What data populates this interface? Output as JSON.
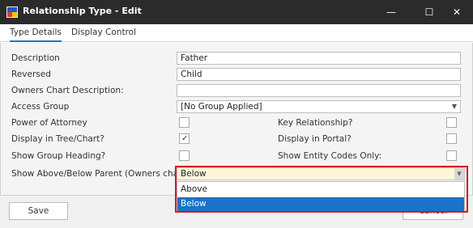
{
  "window": {
    "title": "Relationship Type - Edit",
    "minimize_glyph": "—",
    "maximize_glyph": "☐",
    "close_glyph": "✕"
  },
  "tabs": [
    {
      "label": "Type Details",
      "active": true
    },
    {
      "label": "Display Control",
      "active": false
    }
  ],
  "form": {
    "description": {
      "label": "Description",
      "value": "Father"
    },
    "reversed": {
      "label": "Reversed",
      "value": "Child"
    },
    "owners_chart_description": {
      "label": "Owners Chart Description:",
      "value": ""
    },
    "access_group": {
      "label": "Access Group",
      "value": "[No Group Applied]",
      "arrow": "▼"
    },
    "power_of_attorney": {
      "label": "Power of Attorney",
      "checked": false
    },
    "key_relationship": {
      "label": "Key Relationship?",
      "checked": false
    },
    "display_in_tree": {
      "label": "Display in Tree/Chart?",
      "checked": true,
      "mark": "✓"
    },
    "display_in_portal": {
      "label": "Display in Portal?",
      "checked": false
    },
    "show_group_heading": {
      "label": "Show Group Heading?",
      "checked": false
    },
    "show_entity_codes": {
      "label": "Show Entity Codes Only:",
      "checked": false
    },
    "show_above_below": {
      "label": "Show Above/Below Parent (Owners chart):",
      "value": "Below",
      "arrow": "▼",
      "options": [
        "Above",
        "Below"
      ],
      "highlighted_option": "Below"
    }
  },
  "footer": {
    "save_label": "Save",
    "cancel_label": "Cancel"
  },
  "colors": {
    "titlebar": "#2b2b2b",
    "selection": "#1a73c8",
    "highlight_border": "#d11a2a",
    "dropdown_field": "#fdf6d8"
  },
  "icons": [
    "app-icon",
    "minimize-icon",
    "maximize-icon",
    "close-icon",
    "chevron-down-icon",
    "checkmark-icon"
  ]
}
